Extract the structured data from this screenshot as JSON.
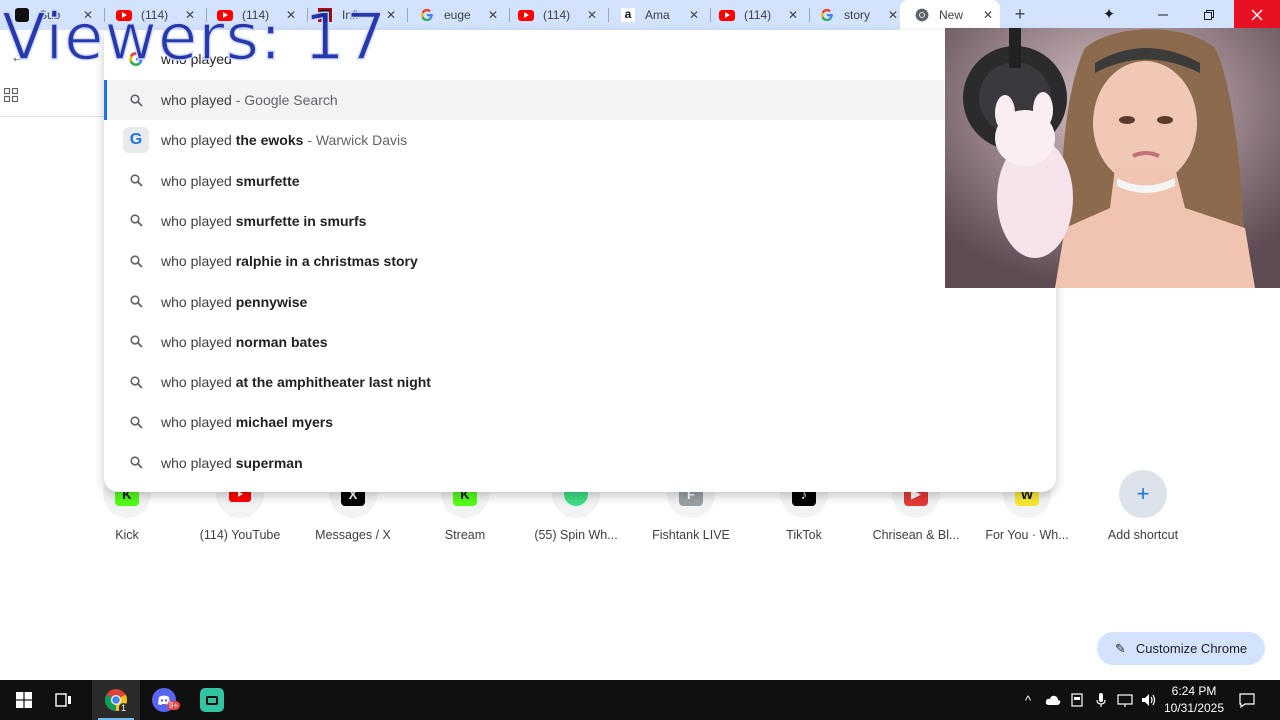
{
  "tabs": [
    {
      "title": "Sub",
      "favicon": "streaming-icon",
      "active": false
    },
    {
      "title": "(114)",
      "favicon": "youtube-icon",
      "active": false
    },
    {
      "title": "(114)",
      "favicon": "youtube-icon",
      "active": false
    },
    {
      "title": "Infi",
      "favicon": "netflix-icon",
      "active": false
    },
    {
      "title": "euge",
      "favicon": "google-icon",
      "active": false
    },
    {
      "title": "(114)",
      "favicon": "youtube-icon",
      "active": false
    },
    {
      "title": "Ama",
      "favicon": "amazon-icon",
      "active": false
    },
    {
      "title": "(114)",
      "favicon": "youtube-icon",
      "active": false
    },
    {
      "title": "story",
      "favicon": "google-icon",
      "active": false
    },
    {
      "title": "New",
      "favicon": "chrome-icon",
      "active": true
    }
  ],
  "omnibox": {
    "input_value": "who played",
    "suggestions": [
      {
        "prefix": "who played",
        "bold": "",
        "suffix": " - Google Search",
        "icon": "search-icon",
        "selected": true
      },
      {
        "prefix": "who played ",
        "bold": "the ewoks",
        "suffix": " - Warwick Davis",
        "icon": "google-g-icon",
        "selected": false
      },
      {
        "prefix": "who played ",
        "bold": "smurfette",
        "suffix": "",
        "icon": "search-icon",
        "selected": false
      },
      {
        "prefix": "who played ",
        "bold": "smurfette in smurfs",
        "suffix": "",
        "icon": "search-icon",
        "selected": false
      },
      {
        "prefix": "who played ",
        "bold": "ralphie in a christmas story",
        "suffix": "",
        "icon": "search-icon",
        "selected": false
      },
      {
        "prefix": "who played ",
        "bold": "pennywise",
        "suffix": "",
        "icon": "search-icon",
        "selected": false
      },
      {
        "prefix": "who played ",
        "bold": "norman bates",
        "suffix": "",
        "icon": "search-icon",
        "selected": false
      },
      {
        "prefix": "who played ",
        "bold": "at the amphitheater last night",
        "suffix": "",
        "icon": "search-icon",
        "selected": false
      },
      {
        "prefix": "who played ",
        "bold": "michael myers",
        "suffix": "",
        "icon": "search-icon",
        "selected": false
      },
      {
        "prefix": "who played ",
        "bold": "superman",
        "suffix": "",
        "icon": "search-icon",
        "selected": false
      }
    ]
  },
  "shortcuts": [
    {
      "label": "Kick",
      "icon": "kick-icon",
      "color": "#53fc18"
    },
    {
      "label": "(114) YouTube",
      "icon": "youtube-icon",
      "color": "#ff0000"
    },
    {
      "label": "Messages / X",
      "icon": "x-icon",
      "color": "#000000"
    },
    {
      "label": "Stream",
      "icon": "kick-icon",
      "color": "#53fc18"
    },
    {
      "label": "(55) Spin Wh...",
      "icon": "spin-wheel-icon",
      "color": "#3ddc84"
    },
    {
      "label": "Fishtank LIVE",
      "icon": "fishtank-icon",
      "color": "#9aa0a6"
    },
    {
      "label": "TikTok",
      "icon": "tiktok-icon",
      "color": "#000000"
    },
    {
      "label": "Chrisean & Bl...",
      "icon": "video-icon",
      "color": "#e53935"
    },
    {
      "label": "For You · Wh...",
      "icon": "whatnot-icon",
      "color": "#f7e733"
    },
    {
      "label": "Add shortcut",
      "icon": "plus-icon",
      "color": "#1a73e8"
    }
  ],
  "customize_label": "Customize Chrome",
  "overlay": {
    "viewers_text": "Viewers: 17"
  },
  "taskbar": {
    "apps": [
      "windows-start-icon",
      "task-view-icon",
      "chrome-icon",
      "discord-icon",
      "streamlabs-icon"
    ],
    "chrome_badge": "1",
    "discord_badge": "9+",
    "time": "6:24 PM",
    "date": "10/31/2025"
  }
}
